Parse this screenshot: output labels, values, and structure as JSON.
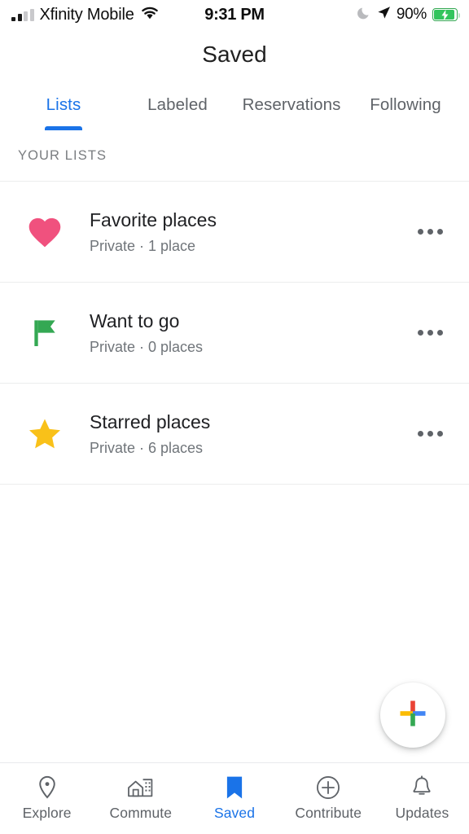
{
  "status_bar": {
    "carrier": "Xfinity Mobile",
    "time": "9:31 PM",
    "battery_percent": "90%",
    "icons": {
      "signal": "signal-bars-icon",
      "wifi": "wifi-icon",
      "do_not_disturb": "moon-icon",
      "location": "location-arrow-icon",
      "battery": "battery-charging-icon"
    }
  },
  "header": {
    "title": "Saved"
  },
  "tabs": [
    {
      "label": "Lists",
      "active": true
    },
    {
      "label": "Labeled",
      "active": false
    },
    {
      "label": "Reservations",
      "active": false
    },
    {
      "label": "Following",
      "active": false
    }
  ],
  "section": {
    "title": "YOUR LISTS"
  },
  "lists": [
    {
      "icon": "heart-icon",
      "icon_color": "#F0517E",
      "title": "Favorite places",
      "subtitle": "Private · 1 place",
      "menu": "overflow-menu-icon"
    },
    {
      "icon": "flag-icon",
      "icon_color": "#34A853",
      "title": "Want to go",
      "subtitle": "Private · 0 places",
      "menu": "overflow-menu-icon"
    },
    {
      "icon": "star-icon",
      "icon_color": "#F9C119",
      "title": "Starred places",
      "subtitle": "Private · 6 places",
      "menu": "overflow-menu-icon"
    }
  ],
  "fab": {
    "icon": "google-plus-add-icon",
    "colors": {
      "top": "#EA4335",
      "left": "#FBBC04",
      "right": "#4285F4",
      "bottom": "#34A853"
    }
  },
  "bottom_nav": [
    {
      "label": "Explore",
      "icon": "map-pin-icon",
      "active": false
    },
    {
      "label": "Commute",
      "icon": "home-building-icon",
      "active": false
    },
    {
      "label": "Saved",
      "icon": "bookmark-icon",
      "active": true
    },
    {
      "label": "Contribute",
      "icon": "plus-circle-icon",
      "active": false
    },
    {
      "label": "Updates",
      "icon": "bell-icon",
      "active": false
    }
  ],
  "theme": {
    "accent": "#1a73e8",
    "text_primary": "#202124",
    "text_secondary": "#5f6368",
    "divider": "#eceded"
  }
}
